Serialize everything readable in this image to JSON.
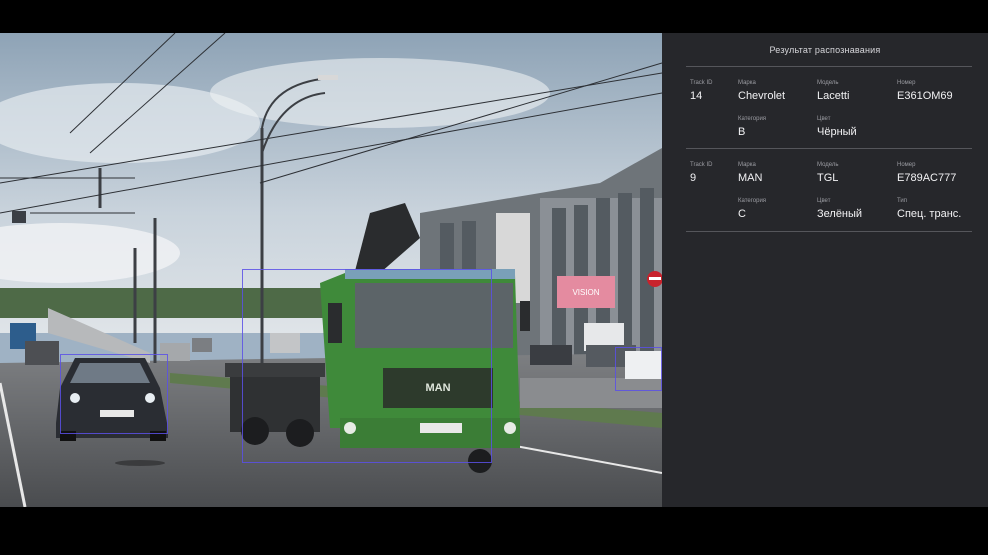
{
  "panel": {
    "title": "Результат распознавания",
    "tracks": [
      {
        "track_id": {
          "label": "Track ID",
          "value": "14"
        },
        "brand": {
          "label": "Марка",
          "value": "Chevrolet"
        },
        "model": {
          "label": "Модель",
          "value": "Lacetti"
        },
        "plate": {
          "label": "Номер",
          "value": "E361OM69"
        },
        "category": {
          "label": "Категория",
          "value": "B"
        },
        "color": {
          "label": "Цвет",
          "value": "Чёрный"
        }
      },
      {
        "track_id": {
          "label": "Track ID",
          "value": "9"
        },
        "brand": {
          "label": "Марка",
          "value": "MAN"
        },
        "model": {
          "label": "Модель",
          "value": "TGL"
        },
        "plate": {
          "label": "Номер",
          "value": "E789AC777"
        },
        "category": {
          "label": "Категория",
          "value": "C"
        },
        "color": {
          "label": "Цвет",
          "value": "Зелёный"
        },
        "type": {
          "label": "Тип",
          "value": "Спец. транс."
        }
      }
    ]
  },
  "scene": {
    "truck_badge": "MAN",
    "billboard_text": "VISION"
  },
  "colors": {
    "panel_bg": "#26272b",
    "bbox": "#5a50e6",
    "truck_green": "#3f8a3a"
  }
}
